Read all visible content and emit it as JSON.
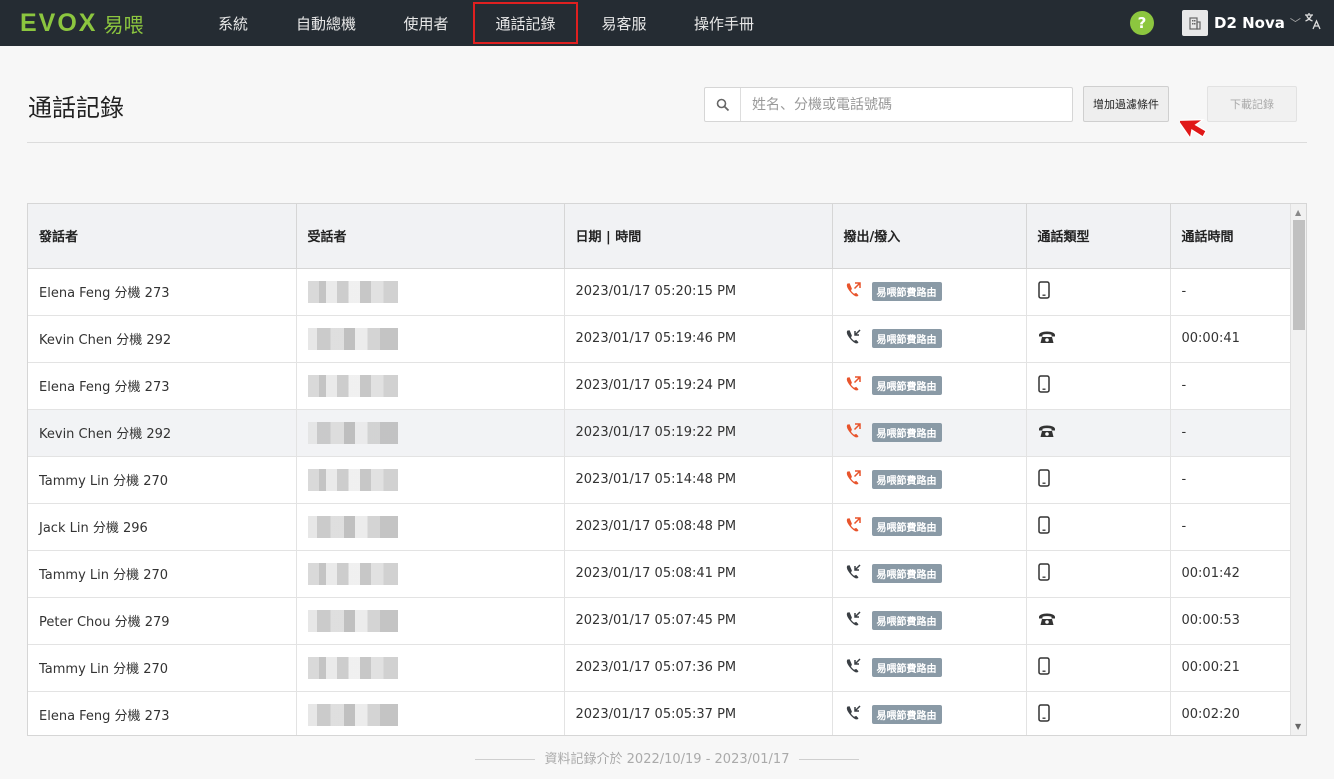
{
  "brand": {
    "logo_text": "EVOX",
    "logo_cn": "易喂",
    "accent": "#8cc63f"
  },
  "nav": {
    "items": [
      {
        "label": "系統",
        "active": false
      },
      {
        "label": "自動總機",
        "active": false
      },
      {
        "label": "使用者",
        "active": false
      },
      {
        "label": "通話記錄",
        "active": true
      },
      {
        "label": "易客服",
        "active": false
      },
      {
        "label": "操作手冊",
        "active": false
      }
    ],
    "help_label": "?",
    "account_name": "D2 Nova",
    "language_icon": "translate-icon"
  },
  "page": {
    "title": "通話記錄",
    "search_placeholder": "姓名、分機或電話號碼",
    "filter_button": "增加過濾條件",
    "download_button": "下載記錄"
  },
  "table": {
    "headers": [
      "發話者",
      "受話者",
      "日期 | 時間",
      "撥出/撥入",
      "通話類型",
      "通話時間"
    ],
    "rows": [
      {
        "caller": "Elena Feng 分機 273",
        "datetime": "2023/01/17 05:20:15 PM",
        "direction": "outgoing",
        "route": "易喂節費路由",
        "type": "mobile",
        "duration": "-"
      },
      {
        "caller": "Kevin Chen 分機 292",
        "datetime": "2023/01/17 05:19:46 PM",
        "direction": "incoming",
        "route": "易喂節費路由",
        "type": "landline",
        "duration": "00:00:41"
      },
      {
        "caller": "Elena Feng 分機 273",
        "datetime": "2023/01/17 05:19:24 PM",
        "direction": "outgoing",
        "route": "易喂節費路由",
        "type": "mobile",
        "duration": "-"
      },
      {
        "caller": "Kevin Chen 分機 292",
        "datetime": "2023/01/17 05:19:22 PM",
        "direction": "outgoing",
        "route": "易喂節費路由",
        "type": "landline",
        "duration": "-"
      },
      {
        "caller": "Tammy Lin 分機 270",
        "datetime": "2023/01/17 05:14:48 PM",
        "direction": "outgoing",
        "route": "易喂節費路由",
        "type": "mobile",
        "duration": "-"
      },
      {
        "caller": "Jack Lin 分機 296",
        "datetime": "2023/01/17 05:08:48 PM",
        "direction": "outgoing",
        "route": "易喂節費路由",
        "type": "mobile",
        "duration": "-"
      },
      {
        "caller": "Tammy Lin 分機 270",
        "datetime": "2023/01/17 05:08:41 PM",
        "direction": "incoming",
        "route": "易喂節費路由",
        "type": "mobile",
        "duration": "00:01:42"
      },
      {
        "caller": "Peter Chou 分機 279",
        "datetime": "2023/01/17 05:07:45 PM",
        "direction": "incoming",
        "route": "易喂節費路由",
        "type": "landline",
        "duration": "00:00:53"
      },
      {
        "caller": "Tammy Lin 分機 270",
        "datetime": "2023/01/17 05:07:36 PM",
        "direction": "incoming",
        "route": "易喂節費路由",
        "type": "mobile",
        "duration": "00:00:21"
      },
      {
        "caller": "Elena Feng 分機 273",
        "datetime": "2023/01/17 05:05:37 PM",
        "direction": "incoming",
        "route": "易喂節費路由",
        "type": "mobile",
        "duration": "00:02:20"
      }
    ]
  },
  "footer": {
    "range_text": "資料記錄介於 2022/10/19 - 2023/01/17"
  },
  "colors": {
    "outgoing": "#e8542c",
    "incoming": "#3a3f44",
    "badge": "#8a9aa6",
    "active_nav_border": "#e02020"
  }
}
